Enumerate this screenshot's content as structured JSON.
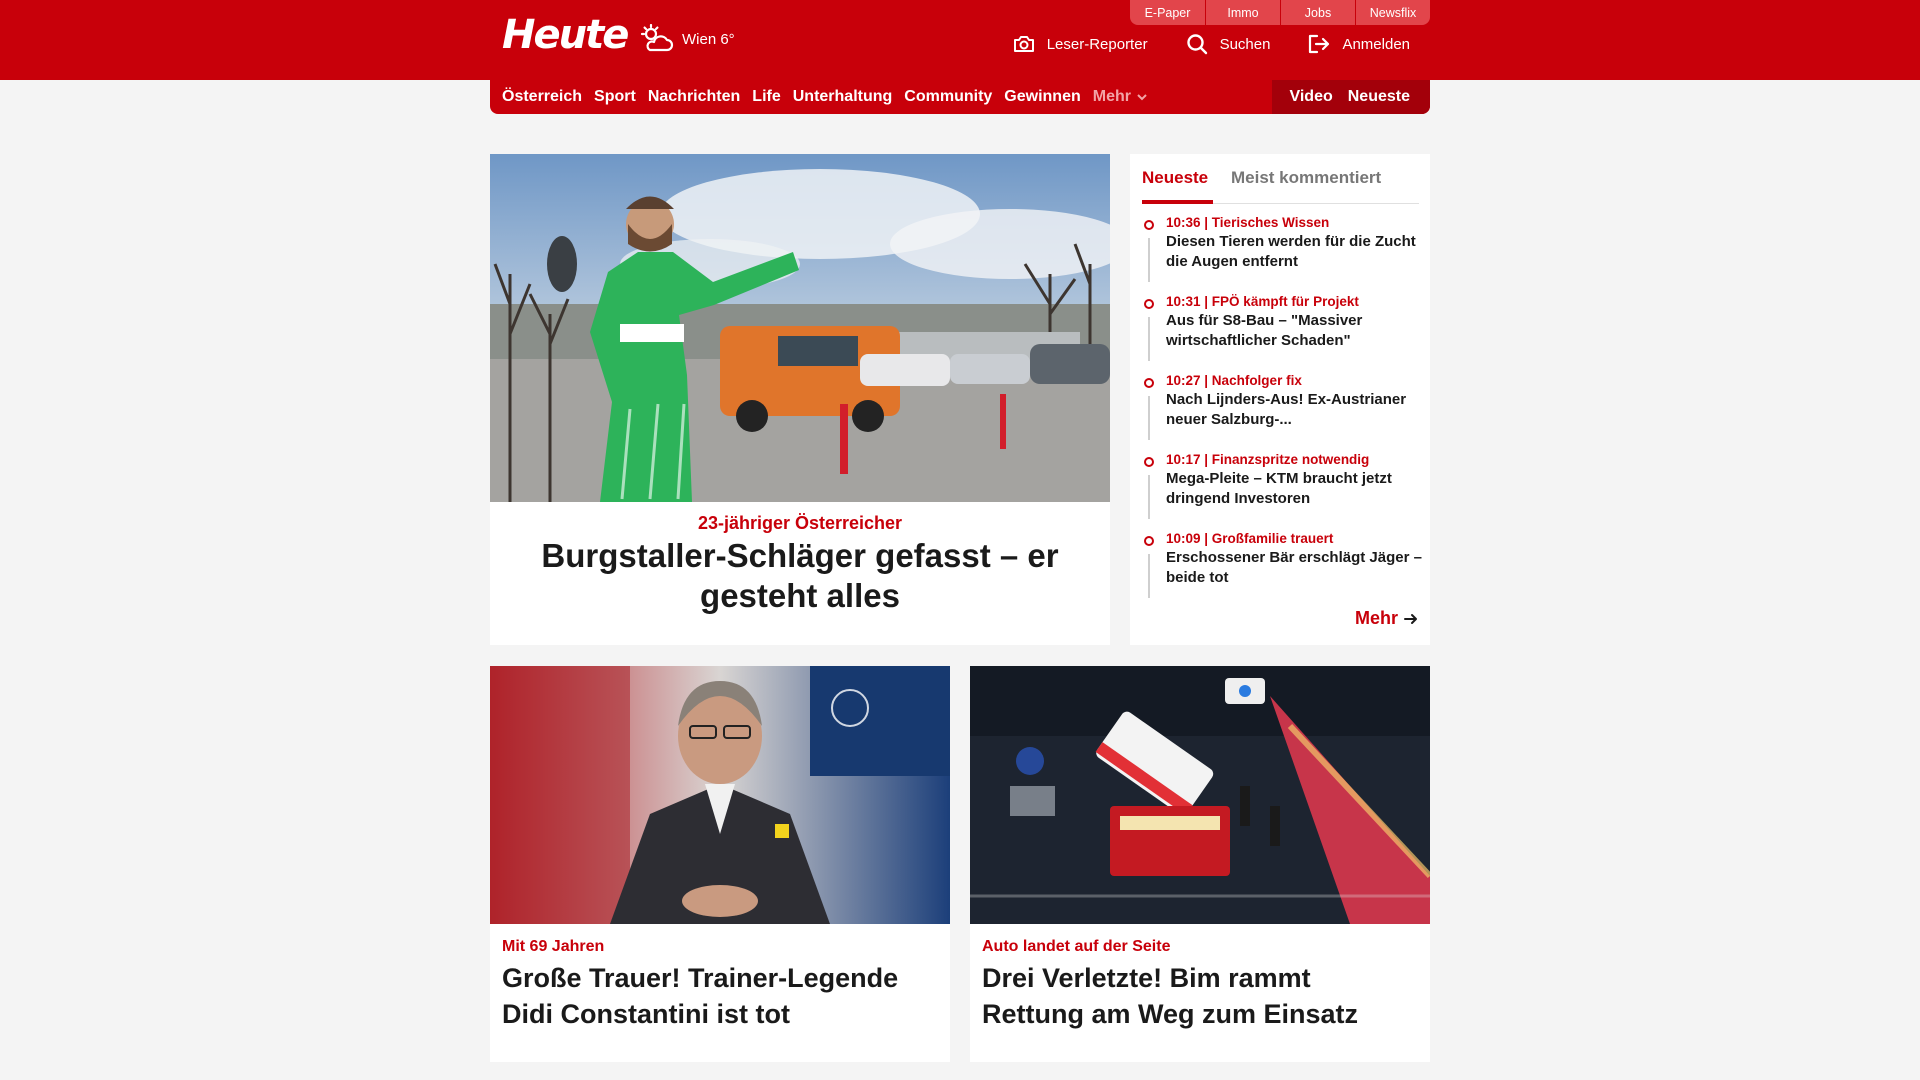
{
  "header": {
    "logo": "Heute",
    "weather": "Wien 6°",
    "service_tabs": [
      "E-Paper",
      "Immo",
      "Jobs",
      "Newsflix"
    ],
    "actions": {
      "reporter": "Leser-Reporter",
      "search": "Suchen",
      "login": "Anmelden"
    }
  },
  "nav": {
    "items": [
      "Österreich",
      "Sport",
      "Nachrichten",
      "Life",
      "Unterhaltung",
      "Community",
      "Gewinnen"
    ],
    "more": "Mehr",
    "video": "Video",
    "latest": "Neueste"
  },
  "hero": {
    "kicker": "23-jähriger Österreicher",
    "title": "Burgstaller-Schläger gefasst – er gesteht alles"
  },
  "sidebar": {
    "tab_active": "Neueste",
    "tab_other": "Meist kommentiert",
    "items": [
      {
        "meta": "10:36 | Tierisches Wissen",
        "title": "Diesen Tieren werden für die Zucht die Augen entfernt"
      },
      {
        "meta": "10:31 | FPÖ kämpft für Projekt",
        "title": "Aus für S8-Bau – \"Massiver wirtschaftlicher Schaden\""
      },
      {
        "meta": "10:27 | Nachfolger fix",
        "title": "Nach Lijnders-Aus! Ex-Austrianer neuer Salzburg-..."
      },
      {
        "meta": "10:17 | Finanzspritze notwendig",
        "title": "Mega-Pleite – KTM braucht jetzt dringend Investoren"
      },
      {
        "meta": "10:09 | Großfamilie trauert",
        "title": "Erschossener Bär erschlägt Jäger – beide tot"
      }
    ],
    "more": "Mehr"
  },
  "cards": [
    {
      "kicker": "Mit 69 Jahren",
      "title": "Große Trauer! Trainer-Legende Didi Constantini ist tot"
    },
    {
      "kicker": "Auto landet auf der Seite",
      "title": "Drei Verletzte! Bim rammt Rettung am Weg zum Einsatz"
    }
  ],
  "colors": {
    "brand_red": "#c8000a",
    "nav_dark_red": "#a3000a",
    "service_tab_red": "#e2454b",
    "page_bg": "#f4f4f4"
  },
  "icons": [
    "weather-cloud-sun-icon",
    "camera-icon",
    "search-icon",
    "login-icon",
    "chevron-down-icon",
    "arrow-right-icon"
  ]
}
